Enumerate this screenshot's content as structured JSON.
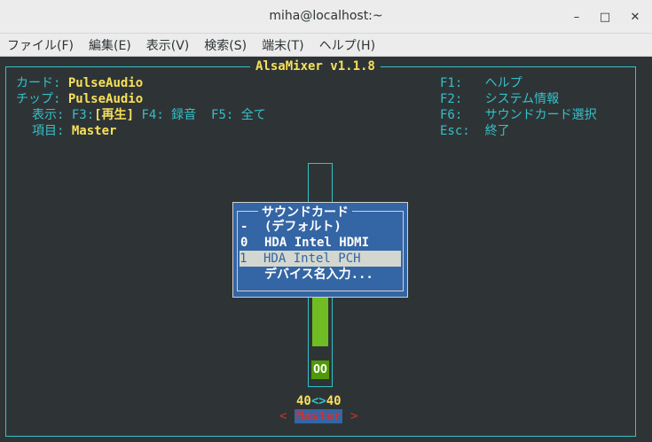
{
  "window": {
    "title": "miha@localhost:~",
    "minimize_glyph": "–",
    "maximize_glyph": "□",
    "close_glyph": "✕"
  },
  "menu": {
    "items": [
      {
        "label": "ファイル(F)"
      },
      {
        "label": "編集(E)"
      },
      {
        "label": "表示(V)"
      },
      {
        "label": "検索(S)"
      },
      {
        "label": "端末(T)"
      },
      {
        "label": "ヘルプ(H)"
      }
    ]
  },
  "alsamixer": {
    "title": "AlsaMixer v1.1.8",
    "info": {
      "card_label": "カード:",
      "card_value": "PulseAudio",
      "chip_label": "チップ:",
      "chip_value": "PulseAudio",
      "view_label": "表示:",
      "view_f3": "F3:",
      "view_current": "[再生]",
      "view_f4": "F4: 録音",
      "view_f5": "F5: 全て",
      "item_label": "項目:",
      "item_value": "Master"
    },
    "help": {
      "f1_key": "F1:",
      "f1_text": "ヘルプ",
      "f2_key": "F2:",
      "f2_text": "システム情報",
      "f6_key": "F6:",
      "f6_text": "サウンドカード選択",
      "esc_key": "Esc:",
      "esc_text": "終了"
    },
    "control": {
      "mute_state": "OO",
      "level_left": "40",
      "level_sep": "<>",
      "level_right": "40",
      "arrow_left": "<",
      "name": "Master",
      "arrow_right": ">",
      "volume_percent": 40
    }
  },
  "soundcard_popup": {
    "title": "サウンドカード",
    "items": [
      {
        "key": "-",
        "label": "(デフォルト)",
        "selected": false
      },
      {
        "key": "0",
        "label": "HDA Intel HDMI",
        "selected": false
      },
      {
        "key": "1",
        "label": "HDA Intel PCH",
        "selected": true
      },
      {
        "key": "",
        "label": "デバイス名入力...",
        "selected": false
      }
    ]
  },
  "colors": {
    "terminal_bg": "#2e3436",
    "cyan": "#34c1c9",
    "yellow": "#f7e05a",
    "popup_bg": "#3465a4",
    "volume_green": "#6fbd22"
  }
}
